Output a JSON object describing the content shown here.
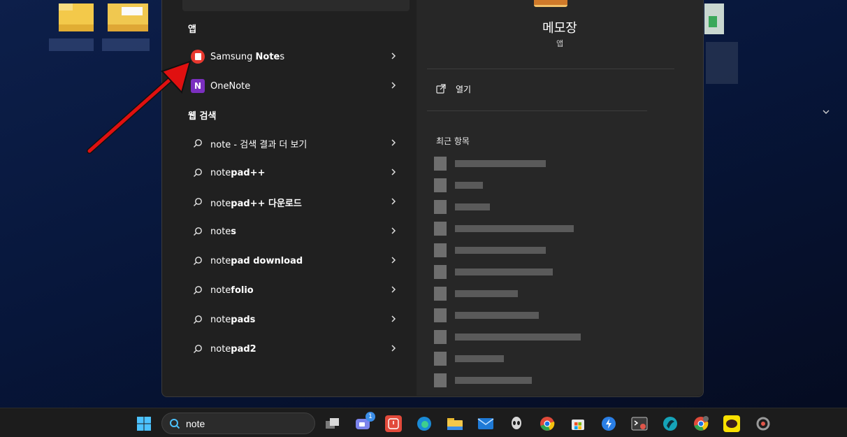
{
  "search_panel": {
    "apps_header": "앱",
    "apps": [
      {
        "name": "Samsung Notes"
      },
      {
        "name": "OneNote"
      }
    ],
    "web_header": "웹 검색",
    "web_results": [
      {
        "normal": "note",
        "bold": "",
        "suffix": " - 검색 결과 더 보기"
      },
      {
        "normal": "note",
        "bold": "pad++",
        "suffix": ""
      },
      {
        "normal": "note",
        "bold": "pad++ 다운로드",
        "suffix": ""
      },
      {
        "normal": "note",
        "bold": "s",
        "suffix": ""
      },
      {
        "normal": "note",
        "bold": "pad download",
        "suffix": ""
      },
      {
        "normal": "note",
        "bold": "folio",
        "suffix": ""
      },
      {
        "normal": "note",
        "bold": "pads",
        "suffix": ""
      },
      {
        "normal": "note",
        "bold": "pad2",
        "suffix": ""
      }
    ]
  },
  "detail": {
    "app_name": "메모장",
    "app_type": "앱",
    "open_label": "열기",
    "recent_header": "최근 항목"
  },
  "taskbar": {
    "search_value": "note",
    "teams_badge": "1"
  },
  "colors": {
    "samsung_notes": "#e8382f",
    "onenote": "#7b2fc0",
    "annotation_arrow": "#e01010"
  }
}
